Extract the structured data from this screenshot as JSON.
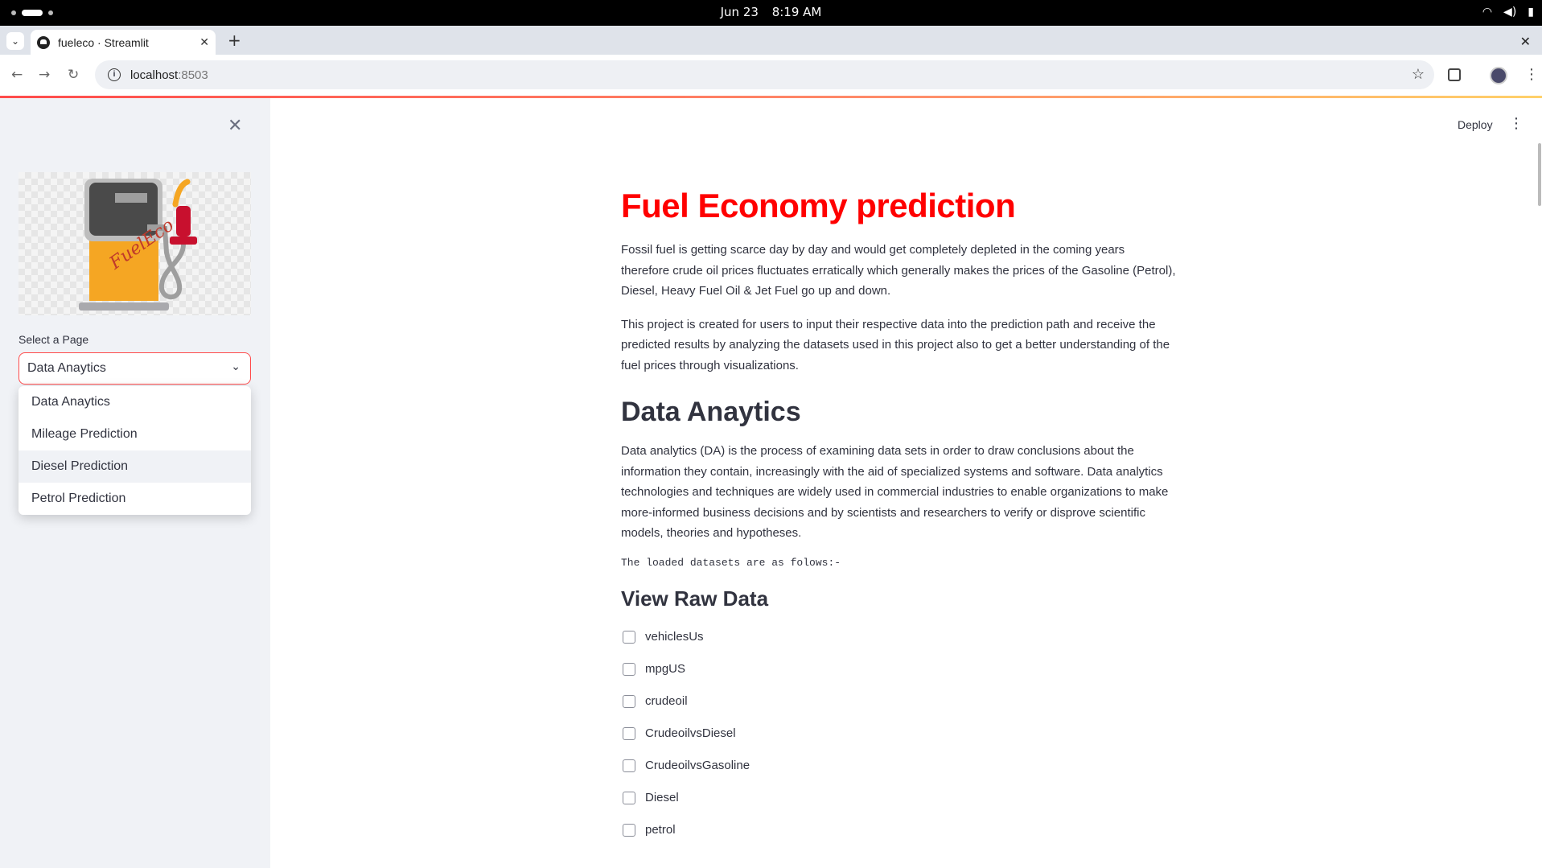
{
  "os": {
    "date": "Jun 23",
    "time": "8:19 AM"
  },
  "browser": {
    "tab_title": "fueleco · Streamlit",
    "url_host": "localhost",
    "url_port": ":8503"
  },
  "header": {
    "deploy_label": "Deploy"
  },
  "sidebar": {
    "select_label": "Select a Page",
    "selected_value": "Data Anaytics",
    "options": [
      "Data Anaytics",
      "Mileage Prediction",
      "Diesel Prediction",
      "Petrol Prediction"
    ],
    "logo_text": "FuelEco"
  },
  "main": {
    "title": "Fuel Economy prediction",
    "intro_p1": "Fossil fuel is getting scarce day by day and would get completely depleted in the coming years therefore crude oil prices fluctuates erratically which generally makes the prices of the Gasoline (Petrol), Diesel, Heavy Fuel Oil & Jet Fuel go up and down.",
    "intro_p2": "This project is created for users to input their respective data into the prediction path and receive the predicted results by analyzing the datasets used in this project also to get a better understanding of the fuel prices through visualizations.",
    "section_title": "Data Anaytics",
    "section_p": "Data analytics (DA) is the process of examining data sets in order to draw conclusions about the information they contain, increasingly with the aid of specialized systems and software. Data analytics technologies and techniques are widely used in commercial industries to enable organizations to make more-informed business decisions and by scientists and researchers to verify or disprove scientific models, theories and hypotheses.",
    "code_line": "The loaded datasets are as folows:-",
    "raw_title": "View Raw Data",
    "checkboxes": [
      "vehiclesUs",
      "mpgUS",
      "crudeoil",
      "CrudeoilvsDiesel",
      "CrudeoilvsGasoline",
      "Diesel",
      "petrol"
    ]
  },
  "colors": {
    "title_red": "#ff0000",
    "accent": "#ff4b4b",
    "sidebar_bg": "#f0f2f6"
  }
}
